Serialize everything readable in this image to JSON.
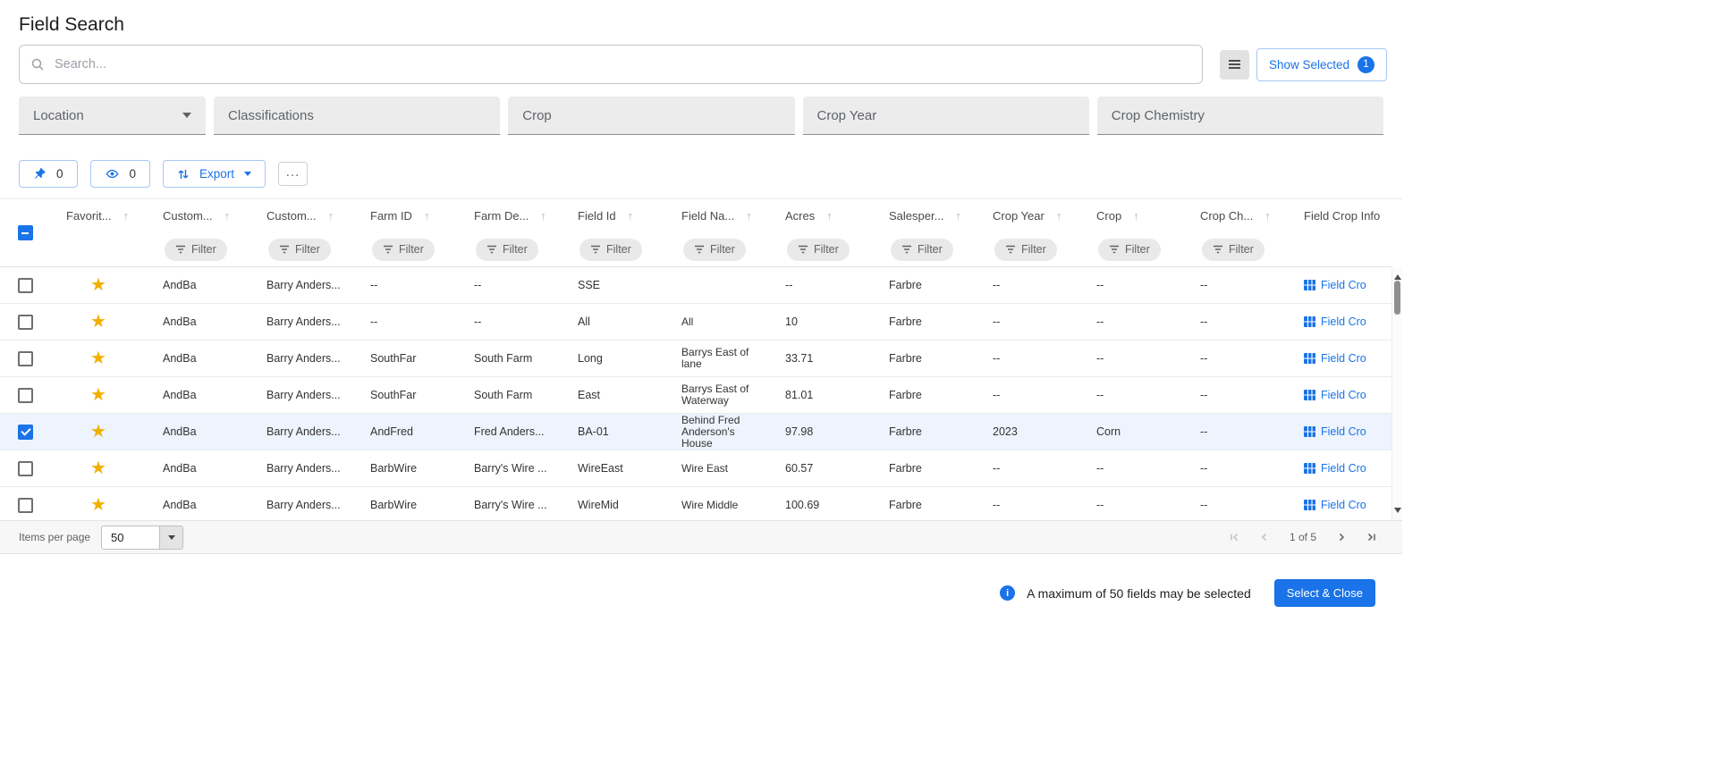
{
  "page": {
    "title": "Field Search"
  },
  "search": {
    "placeholder": "Search..."
  },
  "header": {
    "show_selected_label": "Show Selected",
    "show_selected_count": "1"
  },
  "filters": {
    "location": "Location",
    "classifications": "Classifications",
    "crop": "Crop",
    "crop_year": "Crop Year",
    "crop_chemistry": "Crop Chemistry"
  },
  "toolbar": {
    "pin_count": "0",
    "watch_count": "0",
    "export_label": "Export",
    "more_label": "..."
  },
  "table": {
    "filter_chip_label": "Filter",
    "field_crop_link_label": "Field Cro",
    "columns": [
      {
        "label": "Favorit...",
        "sortable": true,
        "filter": false
      },
      {
        "label": "Custom...",
        "sortable": true,
        "filter": true
      },
      {
        "label": "Custom...",
        "sortable": true,
        "filter": true
      },
      {
        "label": "Farm ID",
        "sortable": true,
        "filter": true
      },
      {
        "label": "Farm De...",
        "sortable": true,
        "filter": true
      },
      {
        "label": "Field Id",
        "sortable": true,
        "filter": true
      },
      {
        "label": "Field Na...",
        "sortable": true,
        "filter": true
      },
      {
        "label": "Acres",
        "sortable": true,
        "filter": true
      },
      {
        "label": "Salesper...",
        "sortable": true,
        "filter": true
      },
      {
        "label": "Crop Year",
        "sortable": true,
        "filter": true
      },
      {
        "label": "Crop",
        "sortable": true,
        "filter": true
      },
      {
        "label": "Crop Ch...",
        "sortable": true,
        "filter": true
      },
      {
        "label": "Field Crop Info",
        "sortable": false,
        "filter": false
      }
    ],
    "rows": [
      {
        "checked": false,
        "favorite": true,
        "customer_code": "AndBa",
        "customer_name": "Barry Anders...",
        "farm_id": "--",
        "farm_desc": "--",
        "field_id": "SSE",
        "field_name": "",
        "acres": "--",
        "salesperson": "Farbre",
        "crop_year": "--",
        "crop": "--",
        "crop_chem": "--"
      },
      {
        "checked": false,
        "favorite": true,
        "customer_code": "AndBa",
        "customer_name": "Barry Anders...",
        "farm_id": "--",
        "farm_desc": "--",
        "field_id": "All",
        "field_name": "All",
        "acres": "10",
        "salesperson": "Farbre",
        "crop_year": "--",
        "crop": "--",
        "crop_chem": "--"
      },
      {
        "checked": false,
        "favorite": true,
        "customer_code": "AndBa",
        "customer_name": "Barry Anders...",
        "farm_id": "SouthFar",
        "farm_desc": "South Farm",
        "field_id": "Long",
        "field_name": "Barrys East of lane",
        "acres": "33.71",
        "salesperson": "Farbre",
        "crop_year": "--",
        "crop": "--",
        "crop_chem": "--"
      },
      {
        "checked": false,
        "favorite": true,
        "customer_code": "AndBa",
        "customer_name": "Barry Anders...",
        "farm_id": "SouthFar",
        "farm_desc": "South Farm",
        "field_id": "East",
        "field_name": "Barrys East of Waterway",
        "acres": "81.01",
        "salesperson": "Farbre",
        "crop_year": "--",
        "crop": "--",
        "crop_chem": "--"
      },
      {
        "checked": true,
        "favorite": true,
        "customer_code": "AndBa",
        "customer_name": "Barry Anders...",
        "farm_id": "AndFred",
        "farm_desc": "Fred Anders...",
        "field_id": "BA-01",
        "field_name": "Behind Fred Anderson's House",
        "acres": "97.98",
        "salesperson": "Farbre",
        "crop_year": "2023",
        "crop": "Corn",
        "crop_chem": "--"
      },
      {
        "checked": false,
        "favorite": true,
        "customer_code": "AndBa",
        "customer_name": "Barry Anders...",
        "farm_id": "BarbWire",
        "farm_desc": "Barry's Wire ...",
        "field_id": "WireEast",
        "field_name": "Wire East",
        "acres": "60.57",
        "salesperson": "Farbre",
        "crop_year": "--",
        "crop": "--",
        "crop_chem": "--"
      },
      {
        "checked": false,
        "favorite": true,
        "customer_code": "AndBa",
        "customer_name": "Barry Anders...",
        "farm_id": "BarbWire",
        "farm_desc": "Barry's Wire ...",
        "field_id": "WireMid",
        "field_name": "Wire Middle",
        "acres": "100.69",
        "salesperson": "Farbre",
        "crop_year": "--",
        "crop": "--",
        "crop_chem": "--"
      }
    ]
  },
  "paginator": {
    "items_per_page_label": "Items per page",
    "page_size": "50",
    "range_label": "1 of 5"
  },
  "footer": {
    "info_text": "A maximum of 50 fields may be selected",
    "select_close_label": "Select & Close"
  },
  "colors": {
    "accent": "#1a73e8",
    "star": "#f1b000"
  }
}
